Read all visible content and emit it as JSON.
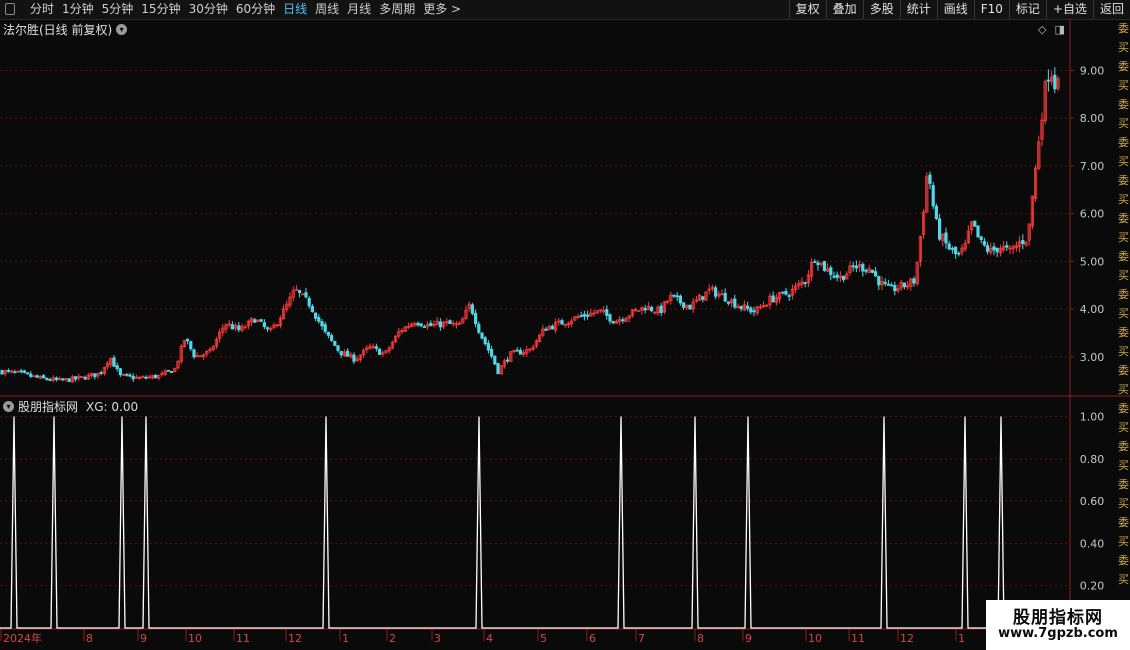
{
  "toolbar": {
    "periods": [
      "分时",
      "1分钟",
      "5分钟",
      "15分钟",
      "30分钟",
      "60分钟",
      "日线",
      "周线",
      "月线",
      "多周期",
      "更多 >"
    ],
    "active_period": "日线",
    "tools": [
      "复权",
      "叠加",
      "多股",
      "统计",
      "画线",
      "F10",
      "标记",
      "+自选",
      "返回"
    ]
  },
  "main_chart": {
    "title": "法尔胜(日线 前复权)",
    "y_ticks": [
      "9.00",
      "8.00",
      "7.00",
      "6.00",
      "5.00",
      "4.00",
      "3.00"
    ]
  },
  "indicator": {
    "name": "股朋指标网",
    "value_text": "XG: 0.00",
    "y_ticks": [
      "1.00",
      "0.80",
      "0.60",
      "0.40",
      "0.20"
    ]
  },
  "time_axis": [
    "2024年",
    "8",
    "9",
    "10",
    "11",
    "12",
    "1",
    "2",
    "3",
    "4",
    "5",
    "6",
    "7",
    "8",
    "9",
    "10",
    "11",
    "12",
    "1"
  ],
  "side_panel_text": "委买委买委买委买委买委买委买委买委买委买委买委买委买委买委买",
  "watermark": {
    "line1": "股朋指标网",
    "line2": "www.7gpzb.com"
  },
  "colors": {
    "up": "#ff3b3b",
    "down": "#4fd8e8",
    "grid": "#5a1414",
    "axis": "#8a1f1f",
    "signal": "#ffffff"
  },
  "chart_data": {
    "type": "candlestick",
    "keypoints": [
      [
        0,
        2.7
      ],
      [
        20,
        2.65
      ],
      [
        40,
        2.55
      ],
      [
        60,
        2.5
      ],
      [
        80,
        2.55
      ],
      [
        100,
        2.65
      ],
      [
        110,
        3.0
      ],
      [
        120,
        2.6
      ],
      [
        140,
        2.55
      ],
      [
        160,
        2.6
      ],
      [
        175,
        2.75
      ],
      [
        185,
        3.4
      ],
      [
        195,
        3.0
      ],
      [
        210,
        3.1
      ],
      [
        225,
        3.7
      ],
      [
        240,
        3.55
      ],
      [
        255,
        3.8
      ],
      [
        270,
        3.5
      ],
      [
        285,
        4.0
      ],
      [
        295,
        4.4
      ],
      [
        310,
        4.1
      ],
      [
        325,
        3.5
      ],
      [
        340,
        3.1
      ],
      [
        355,
        2.95
      ],
      [
        370,
        3.2
      ],
      [
        385,
        3.05
      ],
      [
        400,
        3.55
      ],
      [
        415,
        3.75
      ],
      [
        430,
        3.65
      ],
      [
        445,
        3.7
      ],
      [
        460,
        3.65
      ],
      [
        470,
        4.1
      ],
      [
        480,
        3.5
      ],
      [
        492,
        3.0
      ],
      [
        498,
        2.7
      ],
      [
        510,
        3.05
      ],
      [
        530,
        3.15
      ],
      [
        545,
        3.6
      ],
      [
        560,
        3.7
      ],
      [
        580,
        3.85
      ],
      [
        600,
        3.95
      ],
      [
        615,
        3.75
      ],
      [
        630,
        3.9
      ],
      [
        645,
        4.05
      ],
      [
        660,
        3.95
      ],
      [
        670,
        4.25
      ],
      [
        690,
        4.05
      ],
      [
        710,
        4.4
      ],
      [
        725,
        4.25
      ],
      [
        740,
        4.05
      ],
      [
        755,
        3.95
      ],
      [
        770,
        4.2
      ],
      [
        790,
        4.35
      ],
      [
        805,
        4.6
      ],
      [
        815,
        5.1
      ],
      [
        825,
        4.85
      ],
      [
        840,
        4.65
      ],
      [
        855,
        4.9
      ],
      [
        870,
        4.85
      ],
      [
        880,
        4.55
      ],
      [
        890,
        4.4
      ],
      [
        905,
        4.5
      ],
      [
        915,
        4.6
      ],
      [
        922,
        5.8
      ],
      [
        928,
        7.0
      ],
      [
        932,
        6.3
      ],
      [
        938,
        5.6
      ],
      [
        948,
        5.3
      ],
      [
        958,
        5.1
      ],
      [
        965,
        5.3
      ],
      [
        972,
        5.8
      ],
      [
        980,
        5.4
      ],
      [
        990,
        5.2
      ],
      [
        1000,
        5.3
      ],
      [
        1010,
        5.2
      ],
      [
        1020,
        5.4
      ],
      [
        1028,
        5.5
      ],
      [
        1032,
        6.3
      ],
      [
        1036,
        7.0
      ],
      [
        1040,
        7.8
      ],
      [
        1045,
        8.6
      ],
      [
        1050,
        9.1
      ],
      [
        1055,
        8.7
      ],
      [
        1060,
        9.2
      ]
    ],
    "ylim": [
      2.2,
      9.7
    ],
    "indicator_series": {
      "name": "XG",
      "signal_x": [
        14,
        54,
        122,
        146,
        326,
        479,
        621,
        695,
        748,
        884,
        965,
        1001
      ],
      "ylim": [
        0,
        1.05
      ]
    }
  }
}
